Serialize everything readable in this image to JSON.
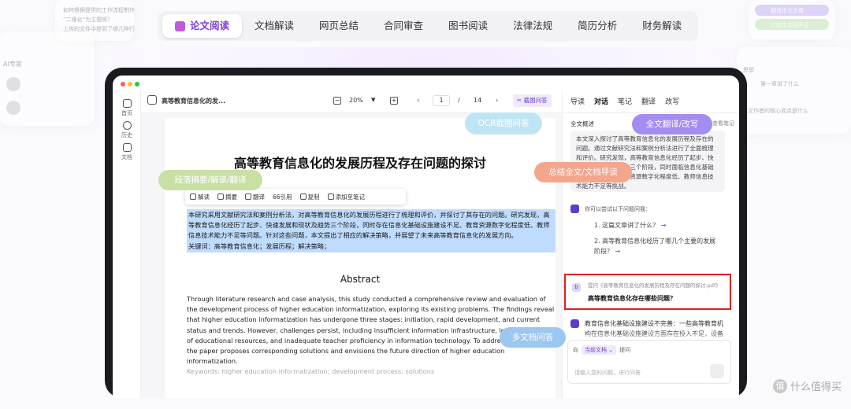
{
  "tabs": [
    "论文阅读",
    "文档解读",
    "网页总结",
    "合同审查",
    "图书阅读",
    "法律法规",
    "简历分析",
    "财务解读"
  ],
  "side": {
    "left_top_lines": [
      "如何根据提供的工作流程制作",
      "“二维化”为主题呢？",
      "上传的文件中提到了哪几种行"
    ],
    "ai_expert": "AI专家",
    "right_top": [
      "翻译本文文章",
      "比较本文的不足"
    ],
    "right_lines": [
      "思想",
      "第一章讲了什么",
      "文作者的核心观点是什么"
    ]
  },
  "nav": {
    "home": "首页",
    "history": "历史",
    "docs": "文档"
  },
  "toolbar": {
    "doc_name": "高等教育信息化的发...",
    "zoom": "20%",
    "page": "1",
    "sep": "/",
    "total": "14",
    "screenshot_qa": "截图问答"
  },
  "doc": {
    "title": "高等教育信息化的发展历程及存在问题的探讨",
    "popbar": [
      "解读",
      "摘要",
      "翻译",
      "引用",
      "复制",
      "添加至笔记"
    ],
    "highlight": "本研究采用文献研究法和案例分析法，对高等教育信息化的发展历程进行了梳理和评价，并探讨了其存在的问题。研究发现，高等教育信息化经历了起步、快速发展和现状及趋势三个阶段，同时存在信息化基础设施建设不足、教育资源数字化程度低、教师信息技术能力不足等问题。针对这些问题，本文提出了相应的解决策略，并展望了未来高等教育信息化的发展方向。",
    "keywords": "关键词：高等教育信息化；发展历程；解决策略；",
    "abstract_heading": "Abstract",
    "abstract": "Through literature research and case analysis, this study conducted a comprehensive review and evaluation of the development process of higher education informatization, exploring its existing problems. The findings reveal that higher education informatization has undergone three stages: initiation, rapid development, and current status and trends. However, challenges persist, including insufficient information infrastructure, low digitization of educational resources, and inadequate teacher proficiency in information technology. To address these issues, the paper proposes corresponding solutions and envisions the future direction of higher education informatization.",
    "en_keywords": "Keywords: higher education informatization; development process; solutions"
  },
  "panel": {
    "tabs": [
      "导读",
      "对话",
      "笔记",
      "翻译",
      "改写"
    ],
    "overview_label": "全文概述",
    "notes_link": "查看笔记",
    "summary": "本文深入探讨了高等教育信息化的发展历程及存在的问题。通过文献研究法和案例分析法进行了全面梳理和评价。研究发现，高等教育信息化经历了起步、快速发展和现状及趋势三个阶段，同时面临信息化基础设施建设不足、教育资源数字化程度低、教师信息技术能力不足等挑战。",
    "q_prompt": "你可以尝试以下问题问我：",
    "questions": [
      "1. 这篇文章讲了什么？",
      "2. 高等教育信息化经历了哪几个主要的发展阶段？"
    ],
    "ref_source": "提问《高等教育信息化的发展历程及存在问题的探讨.pdf》",
    "ref_question": "高等教育信息化存在哪些问题？",
    "answer": "教育信息化基础设施建设不完善：一些高等教育机构在信息化基础设施建设方面存在投入不足，设备陈旧等问题，导致教学应用",
    "input_prefix": "向",
    "input_chip": "当前文档",
    "input_suffix": "提问",
    "input_placeholder": "请输入您的问题，进行问答"
  },
  "bubbles": {
    "ocr": "OCR截图问答",
    "translate": "全文翻译/改写",
    "summarize": "总结全文/文档导读",
    "paragraph": "段落摘要/解读/翻译",
    "multi": "多文档问答"
  },
  "watermark": "什么值得买",
  "colors": {
    "accent": "#7b3fd6",
    "highlight": "#bfdcff",
    "red_box": "#e21b1b"
  }
}
